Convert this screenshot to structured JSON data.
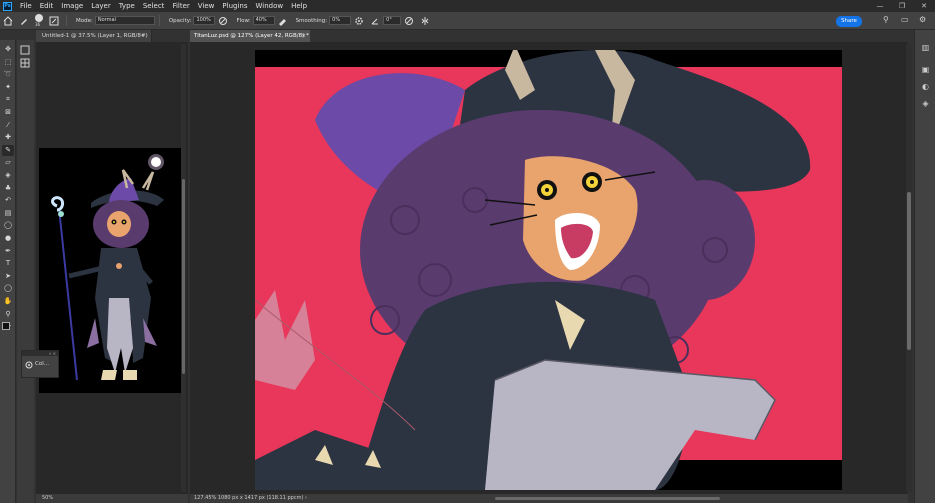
{
  "app": {
    "logo": "Ps",
    "menu": [
      "File",
      "Edit",
      "Image",
      "Layer",
      "Type",
      "Select",
      "Filter",
      "View",
      "Plugins",
      "Window",
      "Help"
    ],
    "window_controls": [
      "—",
      "❐",
      "✕"
    ]
  },
  "options": {
    "brush_size": "36",
    "mode_label": "Mode:",
    "mode_value": "Normal",
    "opacity_label": "Opacity:",
    "opacity_value": "100%",
    "flow_label": "Flow:",
    "flow_value": "40%",
    "smoothing_label": "Smoothing:",
    "smoothing_value": "0%",
    "angle_value": "0°",
    "share_label": "Share"
  },
  "tools": [
    {
      "name": "move-tool",
      "glyph": "✥"
    },
    {
      "name": "marquee-tool",
      "glyph": "⬚"
    },
    {
      "name": "lasso-tool",
      "glyph": "➰"
    },
    {
      "name": "magic-wand-tool",
      "glyph": "✦"
    },
    {
      "name": "crop-tool",
      "glyph": "⌗"
    },
    {
      "name": "frame-tool",
      "glyph": "⊠"
    },
    {
      "name": "eyedropper-tool",
      "glyph": "⁄"
    },
    {
      "name": "healing-tool",
      "glyph": "✚"
    },
    {
      "name": "brush-tool",
      "glyph": "✎"
    },
    {
      "name": "eraser-tool",
      "glyph": "▱"
    },
    {
      "name": "paint-bucket-tool",
      "glyph": "◈"
    },
    {
      "name": "clone-stamp-tool",
      "glyph": "♣"
    },
    {
      "name": "history-brush-tool",
      "glyph": "↶"
    },
    {
      "name": "gradient-tool",
      "glyph": "▤"
    },
    {
      "name": "blur-tool",
      "glyph": "◯"
    },
    {
      "name": "dodge-tool",
      "glyph": "●"
    },
    {
      "name": "pen-tool",
      "glyph": "✒"
    },
    {
      "name": "type-tool",
      "glyph": "T"
    },
    {
      "name": "path-selection-tool",
      "glyph": "➤"
    },
    {
      "name": "ellipse-tool",
      "glyph": "◯"
    },
    {
      "name": "hand-tool",
      "glyph": "✋"
    },
    {
      "name": "zoom-tool",
      "glyph": "⚲"
    },
    {
      "name": "more-tools",
      "glyph": "···"
    }
  ],
  "doc1": {
    "tab_title": "Untitled-1 @ 37.5% (Layer 1, RGB/8#) *",
    "status": "50%"
  },
  "doc2": {
    "tab_title": "TitanLuz.psd @ 127% (Layer 42, RGB/8) *",
    "status": "127.45%    1080 px x 1417 px (118.11 ppcm)    ›"
  },
  "color_panel": {
    "label": "Col..."
  },
  "colors": {
    "accent": "#1473e6",
    "canvas_bg": "#e8375a",
    "hat": "#2c3341",
    "hair": "#5a3b6e",
    "skin": "#e9a36d"
  }
}
